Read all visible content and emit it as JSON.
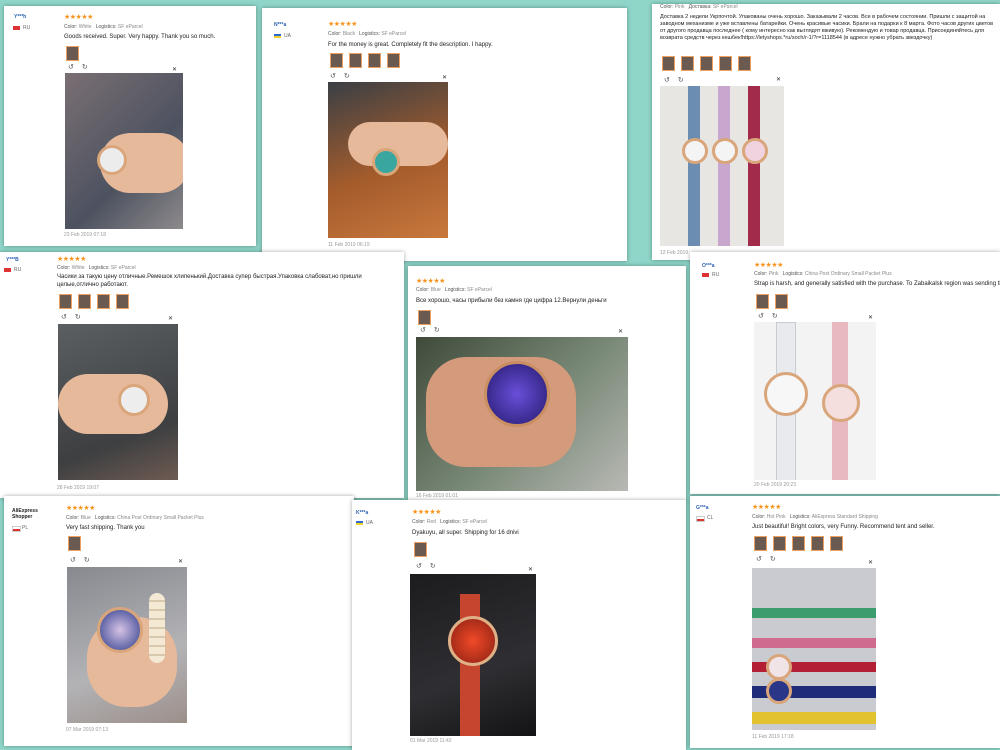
{
  "reviews": [
    {
      "user": "Y***h",
      "country": "RU",
      "stars": "★★★★★",
      "color_label": "Color:",
      "color": "White",
      "log_label": "Logistics:",
      "log": "SF eParcel",
      "text": "Goods received. Super. Very happy. Thank you so much.",
      "date": "23 Feb 2019 07:18"
    },
    {
      "user": "N***a",
      "country": "UA",
      "stars": "★★★★★",
      "color_label": "Color:",
      "color": "Black",
      "log_label": "Logistics:",
      "log": "SF eParcel",
      "text": "For the money is great. Completely fit the description. I happy.",
      "date": "11 Feb 2019 06:19"
    },
    {
      "user": "",
      "country": "",
      "stars": "",
      "color_label": "Color:",
      "color": "Pink",
      "log_label": "Доставка:",
      "log": "SF eParcel",
      "text": "Доставка 2 недели Укрпочтой. Упакованы очень хорошо. Заказывали 2 часов. Все в рабочем состоянии. Пришли с защитой на заводном механизме и уже вставлены батарейки. Очень красивые часики. Брали на подарки к 8 марта. Фото часов других цветов от другого продавца последнее ( кому интересно как выглядят вживую). Рекомендую и товар продавца. Присоединяйтесь для возврата средств через кешбек!https://letyshops.*ru/soch/r-1/?r=1118544 (в адресе нужно убрать звездочку)",
      "date": "12 Feb 2019"
    },
    {
      "user": "Y***B",
      "country": "RU",
      "stars": "★★★★★",
      "color_label": "Color:",
      "color": "White",
      "log_label": "Logistics:",
      "log": "SF eParcel",
      "text": "Часики за такую цену отличные.Ремешок хлипенький.Доставка супер быстрая.Упаковка слабоват,но пришли целые,отлично работают.",
      "date": "28 Feb 2019 19:07"
    },
    {
      "user": "",
      "country": "",
      "stars": "★★★★★",
      "color_label": "Color:",
      "color": "Blue",
      "log_label": "Logistics:",
      "log": "SF eParcel",
      "text": "Все хорошо, часы прибыли без камня где цифра 12.Вернули деньги",
      "date": "16 Feb 2019 01:01"
    },
    {
      "user": "O***a",
      "country": "RU",
      "stars": "★★★★★",
      "color_label": "Color:",
      "color": "Pink",
      "log_label": "Logistics:",
      "log": "China Post Ordinary Small Packet Plus",
      "text": "Strap is harsh, and generally satisfied with the purchase. To Zabaikalsk region was sending three",
      "date": "20 Feb 2019 20:23"
    },
    {
      "user": "AliExpress Shopper",
      "country": "PL",
      "stars": "★★★★★",
      "color_label": "Color:",
      "color": "Blue",
      "log_label": "Logistics:",
      "log": "China Post Ordinary Small Packet Plus",
      "text": "Very fast shipping. Thank you",
      "date": "07 Mar 2019 07:13"
    },
    {
      "user": "K***a",
      "country": "UA",
      "stars": "★★★★★",
      "color_label": "Color:",
      "color": "Red",
      "log_label": "Logistics:",
      "log": "SF eParcel",
      "text": "Dyakuyu, all super. Shipping for 16 dnivi",
      "date": "01 Mar 2019 11:42"
    },
    {
      "user": "G***a",
      "country": "CL",
      "stars": "★★★★★",
      "color_label": "Color:",
      "color": "Hot Pink",
      "log_label": "Logistics:",
      "log": "AliExpress Standard Shipping",
      "text": "Just beautiful! Bright colors, very Funny. Recommend tent and seller.",
      "date": "11 Feb 2019 17:18"
    }
  ],
  "icons": {
    "rotate_left": "↺",
    "rotate_right": "↻",
    "close": "✕"
  }
}
